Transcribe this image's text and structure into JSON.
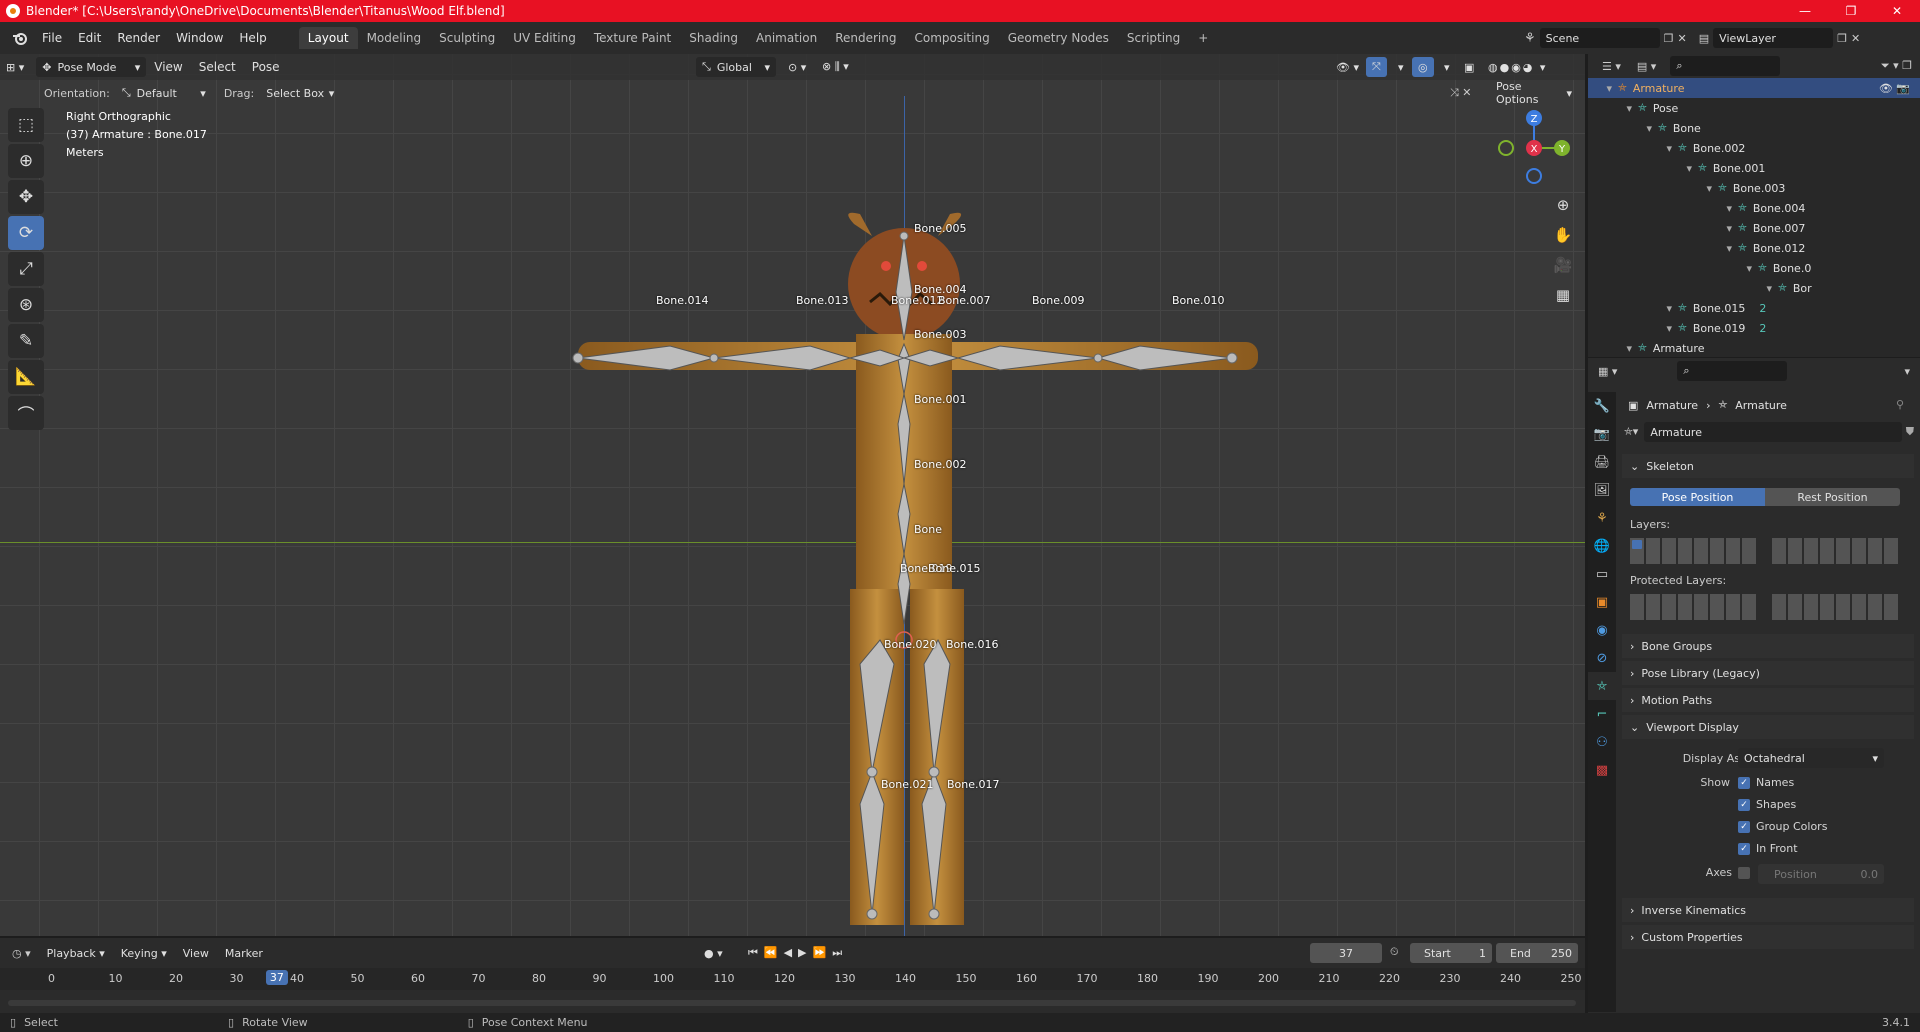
{
  "titlebar": {
    "title": "Blender* [C:\\Users\\randy\\OneDrive\\Documents\\Blender\\Titanus\\Wood Elf.blend]",
    "minimize": "—",
    "maximize": "❐",
    "close": "✕"
  },
  "menu": [
    "File",
    "Edit",
    "Render",
    "Window",
    "Help"
  ],
  "workspaces": [
    "Layout",
    "Modeling",
    "Sculpting",
    "UV Editing",
    "Texture Paint",
    "Shading",
    "Animation",
    "Rendering",
    "Compositing",
    "Geometry Nodes",
    "Scripting"
  ],
  "workspace_add": "+",
  "scene": {
    "label": "Scene",
    "viewlayer": "ViewLayer"
  },
  "viewport": {
    "mode": "Pose Mode",
    "menus": [
      "View",
      "Select",
      "Pose"
    ],
    "transform": "Global",
    "orientation_label": "Orientation:",
    "orientation_value": "Default",
    "drag_label": "Drag:",
    "drag_value": "Select Box",
    "pose_options": "Pose Options",
    "info": [
      "Right Orthographic",
      "(37) Armature : Bone.017",
      "Meters"
    ],
    "gizmo": {
      "z": "Z",
      "y": "Y",
      "x": "X"
    },
    "bones": [
      "Bone.005",
      "Bone.004",
      "Bone.014",
      "Bone.013",
      "Bone.012",
      "Bone.007",
      "Bone.009",
      "Bone.010",
      "Bone.003",
      "Bone.001",
      "Bone.002",
      "Bone",
      "Bone.019",
      "Bone.015",
      "Bone.020",
      "Bone.016",
      "Bone.021",
      "Bone.017"
    ]
  },
  "outliner": {
    "rows": [
      {
        "label": "Armature",
        "indent": 0,
        "selected": true
      },
      {
        "label": "Pose",
        "indent": 1
      },
      {
        "label": "Bone",
        "indent": 2
      },
      {
        "label": "Bone.002",
        "indent": 3
      },
      {
        "label": "Bone.001",
        "indent": 4
      },
      {
        "label": "Bone.003",
        "indent": 5
      },
      {
        "label": "Bone.004",
        "indent": 6
      },
      {
        "label": "Bone.007",
        "indent": 6
      },
      {
        "label": "Bone.012",
        "indent": 6
      },
      {
        "label": "Bone.0",
        "indent": 7
      },
      {
        "label": "Bor",
        "indent": 8
      },
      {
        "label": "Bone.015",
        "indent": 3,
        "badge": "2"
      },
      {
        "label": "Bone.019",
        "indent": 3,
        "badge": "2"
      },
      {
        "label": "Armature",
        "indent": 1
      }
    ]
  },
  "properties": {
    "breadcrumb": [
      "Armature",
      "Armature"
    ],
    "datablock": "Armature",
    "skeleton": {
      "title": "Skeleton",
      "pose_position": "Pose Position",
      "rest_position": "Rest Position",
      "layers_label": "Layers:",
      "protected_label": "Protected Layers:"
    },
    "panels": [
      "Bone Groups",
      "Pose Library (Legacy)",
      "Motion Paths"
    ],
    "viewport_display": {
      "title": "Viewport Display",
      "display_as_label": "Display As",
      "display_as_value": "Octahedral",
      "show_label": "Show",
      "names": "Names",
      "shapes": "Shapes",
      "group_colors": "Group Colors",
      "in_front": "In Front",
      "axes_label": "Axes",
      "position_label": "Position",
      "position_value": "0.0"
    },
    "bottom_panels": [
      "Inverse Kinematics",
      "Custom Properties"
    ]
  },
  "timeline": {
    "menus": [
      "Playback",
      "Keying",
      "View",
      "Marker"
    ],
    "current_frame": "37",
    "start_label": "Start",
    "start": "1",
    "end_label": "End",
    "end": "250",
    "ticks": [
      "0",
      "10",
      "20",
      "30",
      "40",
      "50",
      "60",
      "70",
      "80",
      "90",
      "100",
      "110",
      "120",
      "130",
      "140",
      "150",
      "160",
      "170",
      "180",
      "190",
      "200",
      "210",
      "220",
      "230",
      "240",
      "250"
    ]
  },
  "statusbar": {
    "select": "Select",
    "rotate": "Rotate View",
    "context": "Pose Context Menu",
    "version": "3.4.1"
  },
  "colors": {
    "accent": "#4772b3",
    "title_red": "#e81123",
    "wood": "#b37a2e"
  }
}
